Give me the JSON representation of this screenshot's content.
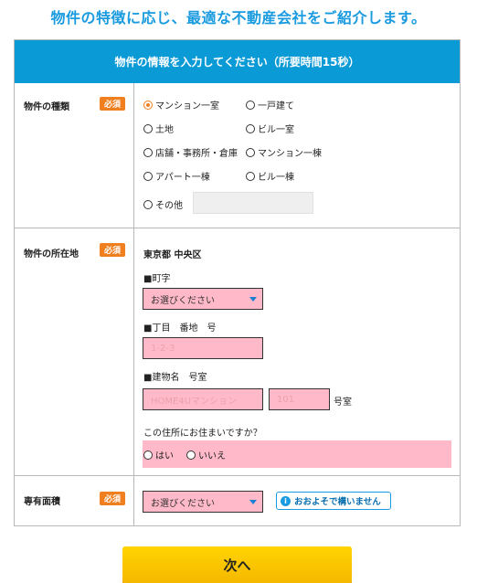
{
  "headline": "物件の特徴に応じ、最適な不動産会社をご紹介します。",
  "form": {
    "header": "物件の情報を入力してください（所要時間15秒）",
    "required_badge": "必須",
    "property_type": {
      "label": "物件の種類",
      "options": [
        "マンション一室",
        "一戸建て",
        "土地",
        "ビル一室",
        "店舗・事務所・倉庫",
        "マンション一棟",
        "アパート一棟",
        "ビル一棟",
        "その他"
      ],
      "selected": "マンション一室"
    },
    "location": {
      "label": "物件の所在地",
      "prefecture_city": "東京都 中央区",
      "town_label": "■町字",
      "town_select": "お選びください",
      "block_label": "■丁目　番地　号",
      "block_placeholder": "1-2-3",
      "building_label": "■建物名　号室",
      "building_placeholder": "HOME4Uマンション",
      "room_placeholder": "101",
      "room_suffix": "号室",
      "residence_question": "この住所にお住まいですか？",
      "yes": "はい",
      "no": "いいえ"
    },
    "area": {
      "label": "専有面積",
      "select": "お選びください",
      "approx_button": "おおよそで構いません"
    }
  },
  "next_button": "次へ",
  "colors": {
    "header_bg": "#0a9ad6",
    "required_badge": "#f07f1f",
    "field_bg": "#ffb9c9",
    "next_button": "#ffd400"
  }
}
